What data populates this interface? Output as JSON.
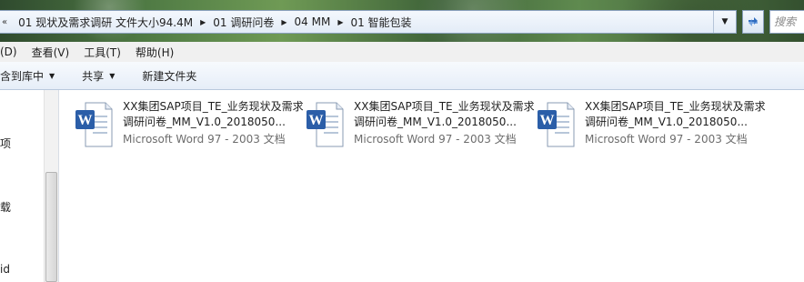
{
  "window": {
    "breadcrumb": [
      "01 现状及需求调研 文件大小94.4M",
      "01 调研问卷",
      "04 MM",
      "01 智能包装"
    ],
    "search_placeholder": "搜索"
  },
  "menu": [
    "(D)",
    "查看(V)",
    "工具(T)",
    "帮助(H)"
  ],
  "toolbar": {
    "include_label": "含到库中",
    "share_label": "共享",
    "new_folder_label": "新建文件夹"
  },
  "nav": [
    "项",
    "载",
    "id"
  ],
  "files": [
    {
      "name": "XX集团SAP项目_TE_业务现状及需求调研问卷_MM_V1.0_2018050...",
      "type": "Microsoft Word 97 - 2003 文档",
      "icon": "word-doc-icon"
    },
    {
      "name": "XX集团SAP项目_TE_业务现状及需求调研问卷_MM_V1.0_2018050...",
      "type": "Microsoft Word 97 - 2003 文档",
      "icon": "word-doc-icon"
    },
    {
      "name": "XX集团SAP项目_TE_业务现状及需求调研问卷_MM_V1.0_2018050...",
      "type": "Microsoft Word 97 - 2003 文档",
      "icon": "word-doc-icon"
    }
  ]
}
